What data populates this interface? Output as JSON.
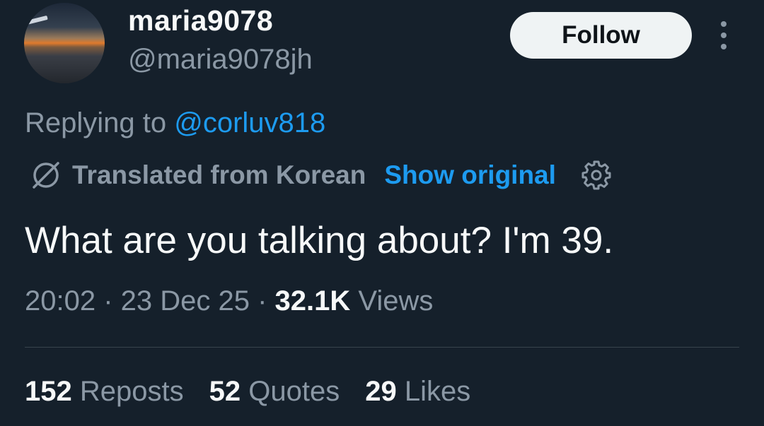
{
  "author": {
    "display_name": "maria9078",
    "handle": "@maria9078jh"
  },
  "follow_label": "Follow",
  "reply": {
    "prefix": "Replying to",
    "mention": "@corluv818"
  },
  "translation": {
    "label": "Translated from Korean",
    "show_original": "Show original"
  },
  "tweet_text": "What are you talking about? I'm 39.",
  "meta": {
    "time": "20:02",
    "sep1": " · ",
    "date": "23 Dec 25",
    "sep2": " · ",
    "views_count": "32.1K",
    "views_label": "Views"
  },
  "stats": {
    "reposts_count": "152",
    "reposts_label": "Reposts",
    "quotes_count": "52",
    "quotes_label": "Quotes",
    "likes_count": "29",
    "likes_label": "Likes"
  },
  "colors": {
    "background": "#15202b",
    "primary_text": "#f7f9f9",
    "secondary_text": "#8b98a5",
    "accent": "#1d9bf0",
    "follow_button": "#eff3f4"
  },
  "icons": [
    "translate-icon",
    "gear-icon",
    "more-icon"
  ]
}
